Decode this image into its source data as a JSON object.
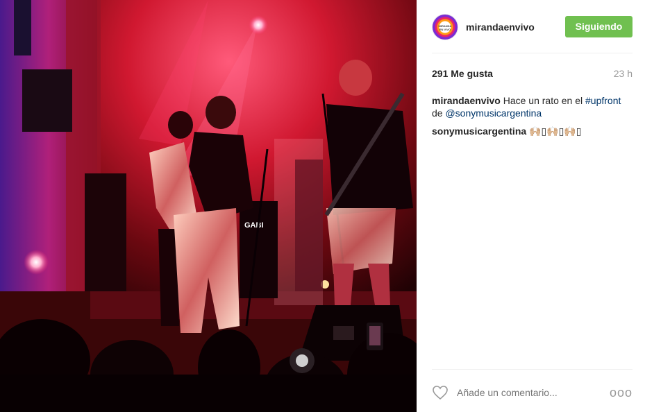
{
  "photo": {
    "alt_icon": "concert-photo",
    "stage_sign": "GABI"
  },
  "account": {
    "username": "mirandaenvivo",
    "avatar_text": "MIRANDA EN VIVO",
    "follow_label": "Siguiendo",
    "follow_color": "#70c050"
  },
  "stats": {
    "likes": "291 Me gusta",
    "time": "23 h"
  },
  "caption": {
    "user": "mirandaenvivo",
    "text_before": " Hace un rato en el ",
    "hashtag": "#upfront",
    "text_mid": " de ",
    "mention": "@sonymusicargentina"
  },
  "reply": {
    "user": "sonymusicargentina",
    "text": " 🙌🏼▯🙌🏼▯🙌🏼▯"
  },
  "comment_box": {
    "placeholder": "Añade un comentario...",
    "more_label": "ooo"
  },
  "colors": {
    "link": "#003569",
    "muted": "#999999",
    "text": "#262626"
  }
}
